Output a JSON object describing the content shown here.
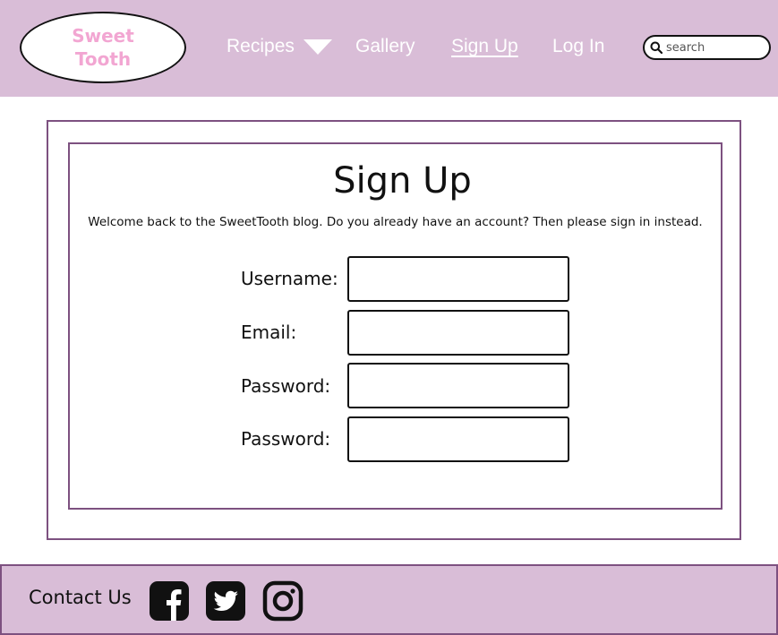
{
  "header": {
    "logo": {
      "line1": "Sweet",
      "line2": "Tooth"
    },
    "nav": {
      "recipes": "Recipes",
      "gallery": "Gallery",
      "sign_up": "Sign Up",
      "log_in": "Log In"
    },
    "search": {
      "placeholder": "search",
      "value": ""
    }
  },
  "main": {
    "title": "Sign Up",
    "subtitle": "Welcome back to the SweetTooth blog. Do you already have an account? Then please sign in instead.",
    "form": {
      "username_label": "Username:",
      "email_label": "Email:",
      "password_label": "Password:",
      "confirm_password_label": "Password:"
    }
  },
  "footer": {
    "contact_label": "Contact Us",
    "social_icons": [
      "facebook-icon",
      "twitter-icon",
      "instagram-icon"
    ]
  },
  "colors": {
    "header_bg": "#d9bdd7",
    "frame_border": "#7d5180",
    "logo_text": "#f2a6d2",
    "nav_text": "#ffffff"
  }
}
